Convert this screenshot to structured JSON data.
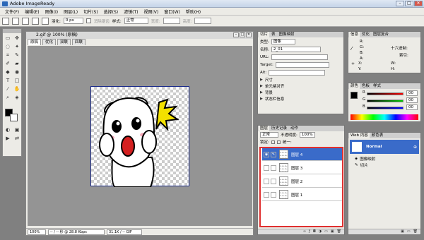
{
  "app": {
    "title": "Adobe ImageReady"
  },
  "window_controls": {
    "minimize": "–",
    "maximize": "□",
    "close": "✕"
  },
  "menu": [
    "文件(F)",
    "编辑(E)",
    "图像(I)",
    "图层(L)",
    "切片(S)",
    "选择(S)",
    "滤镜(T)",
    "视图(V)",
    "窗口(W)",
    "帮助(H)"
  ],
  "options": {
    "feather_label": "羽化:",
    "feather_value": "0 px",
    "antialias_label": "消除锯齿",
    "style_label": "样式:",
    "style_value": "正常",
    "width_label": "宽度:",
    "height_label": "高度:"
  },
  "document": {
    "title": "2.gif @ 100% (原稿)",
    "tabs": [
      "原稿",
      "优化",
      "双联",
      "四联"
    ],
    "status_zoom": "100%",
    "status_time": "-- / -- 秒 @ 28.8 Kbps",
    "status_size": "31.1K / -- GIF"
  },
  "slice_panel": {
    "tabs": [
      "切片",
      "表",
      "图像映射"
    ],
    "type_label": "类型:",
    "type_value": "图像",
    "name_label": "名称:",
    "name_value": "2_01",
    "url_label": "URL:",
    "target_label": "Target:",
    "alt_label": "Alt:",
    "sections": [
      "尺寸",
      "单元格对齐",
      "背景",
      "状态栏信息"
    ]
  },
  "info_panel": {
    "tabs": [
      "信息",
      "优化",
      "图层复合"
    ],
    "r_label": "R:",
    "g_label": "G:",
    "b_label": "B:",
    "a_label": "A:",
    "hex_label": "十六进制:",
    "index_label": "索引:",
    "x_label": "X:",
    "y_label": "Y:",
    "w_label": "W:",
    "h_label": "H:"
  },
  "color_panel": {
    "tabs": [
      "颜色",
      "色板",
      "样式"
    ],
    "r_label": "R",
    "g_label": "G",
    "b_label": "B",
    "r_value": "00",
    "g_value": "00",
    "b_value": "00"
  },
  "layers_panel": {
    "tabs": [
      "图层",
      "历史记录",
      "动作"
    ],
    "blend_mode": "正常",
    "opacity_label": "不透明度:",
    "opacity_value": "100%",
    "lock_label": "锁定:",
    "unify_label": "统一:",
    "layers": [
      "图层 4",
      "图层 3",
      "图层 2",
      "图层 1"
    ]
  },
  "web_content_panel": {
    "tabs": [
      "Web 内容",
      "颜色表"
    ],
    "items": [
      "Normal",
      "图像映射",
      "切片"
    ]
  },
  "colors": {
    "selection": "#3a6bc9",
    "highlight_red": "#e03030",
    "menubar": "#ecebe6"
  }
}
